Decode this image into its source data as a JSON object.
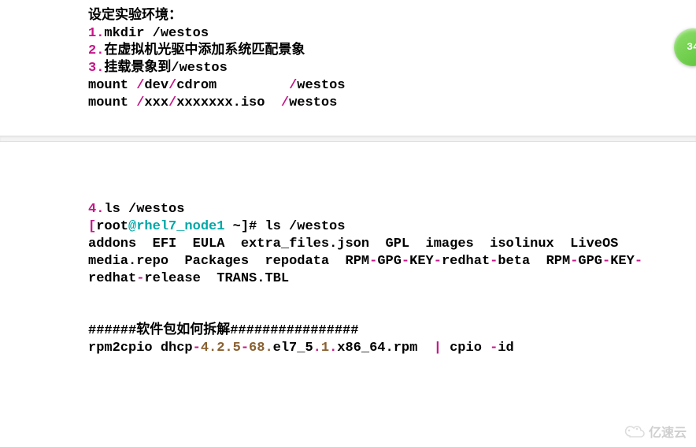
{
  "block1": {
    "title": "设定实验环境：",
    "steps": [
      {
        "num": "1.",
        "text_cn": "",
        "text_cmd": "mkdir /westos"
      },
      {
        "num": "2.",
        "text_cn": "在虚拟机光驱中添加系统匹配景象",
        "text_cmd": ""
      },
      {
        "num": "3.",
        "text_cn": "挂载景象到",
        "text_cmd": "/westos"
      }
    ],
    "mounts": [
      {
        "cmd": "mount",
        "punct1": " /",
        "arg1": "dev",
        "punct2": "/",
        "arg2": "cdrom",
        "gap": "         ",
        "punct3": "/",
        "target": "westos"
      },
      {
        "cmd": "mount",
        "punct1": " /",
        "arg1": "xxx",
        "punct2": "/",
        "arg2": "xxxxxxx.iso",
        "gap": "  ",
        "punct3": "/",
        "target": "westos"
      }
    ]
  },
  "block2": {
    "step": {
      "num": "4.",
      "cmd": "ls /westos"
    },
    "prompt": {
      "open": "[",
      "user": "root",
      "at": "@",
      "host": "rhel7_node1",
      "rest": " ~]# ls /westos"
    },
    "ls_output": "addons  EFI  EULA  extra_files.json  GPL  images  isolinux  LiveOS  media.repo  Packages  repodata  RPM-GPG-KEY-redhat-beta  RPM-GPG-KEY-redhat-release  TRANS.TBL",
    "ls_parts": [
      "addons",
      "EFI",
      "EULA",
      "extra_files.json",
      "GPL",
      "images",
      "isolinux",
      "LiveOS",
      "media.repo",
      "Packages",
      "repodata",
      "RPM",
      "GPG",
      "KEY",
      "redhat",
      "beta",
      "RPM",
      "GPG",
      "KEY",
      "redhat",
      "release",
      "TRANS.TBL"
    ],
    "ls_line1": {
      "words": [
        "addons",
        "EFI",
        "EULA",
        "extra_files.json",
        "GPL",
        "images",
        "isolinux",
        "LiveOS"
      ]
    },
    "ls_line2": {
      "first": "media.repo",
      "w2": "Packages",
      "w3": "repodata",
      "dash_groups": [
        [
          "RPM",
          "GPG",
          "KEY",
          "redhat",
          "beta"
        ],
        [
          "RPM",
          "GPG",
          "KEY"
        ]
      ]
    },
    "ls_line3": {
      "dash_group": [
        "redhat",
        "release"
      ],
      "last": "TRANS.TBL"
    },
    "section_header": {
      "hash_left": "######",
      "text": "软件包如何拆解",
      "hash_right": "################"
    },
    "rpm_line": {
      "p1": "rpm2cpio dhcp",
      "n1": "4.2.5",
      "n2": "68.",
      "p2": "el7_5",
      "n3": "1",
      "p3": "x86_64.rpm  ",
      "pipe": "|",
      "p4": " cpio ",
      "flag": "id"
    }
  },
  "badge": "34",
  "watermark": "亿速云"
}
